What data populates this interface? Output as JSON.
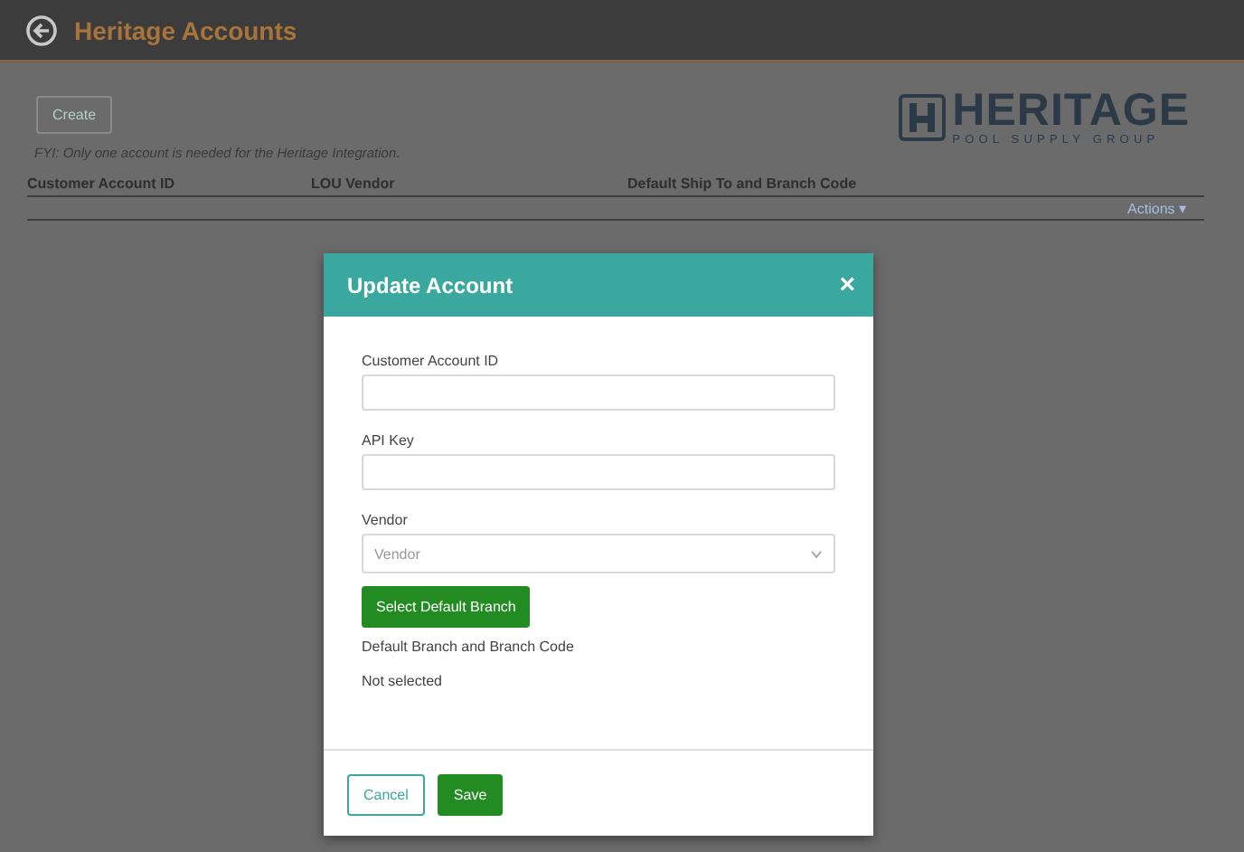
{
  "header": {
    "title": "Heritage Accounts"
  },
  "create_button": {
    "label": "Create",
    "disabled": true
  },
  "note": "FYI: Only one account is needed for the Heritage Integration.",
  "logo": {
    "name": "HERITAGE",
    "tagline": "POOL SUPPLY GROUP"
  },
  "table": {
    "columns": [
      "Customer Account ID",
      "LOU Vendor",
      "Default Ship To and Branch Code"
    ],
    "actions": "Actions ▾"
  },
  "dialog": {
    "title": "Update Account",
    "close": "×",
    "fields": [
      {
        "kind": "text",
        "label": "Customer Account ID"
      },
      {
        "kind": "text",
        "label": "API Key"
      },
      {
        "kind": "select",
        "label": "Vendor",
        "placeholder": "Vendor"
      }
    ],
    "branch_button": "Select Default Branch",
    "branch_label": "Default Branch and Branch Code",
    "branch_value": "Not selected",
    "buttons": [
      {
        "kind": "outline",
        "label": "Cancel"
      },
      {
        "kind": "primary",
        "label": "Save"
      }
    ]
  }
}
